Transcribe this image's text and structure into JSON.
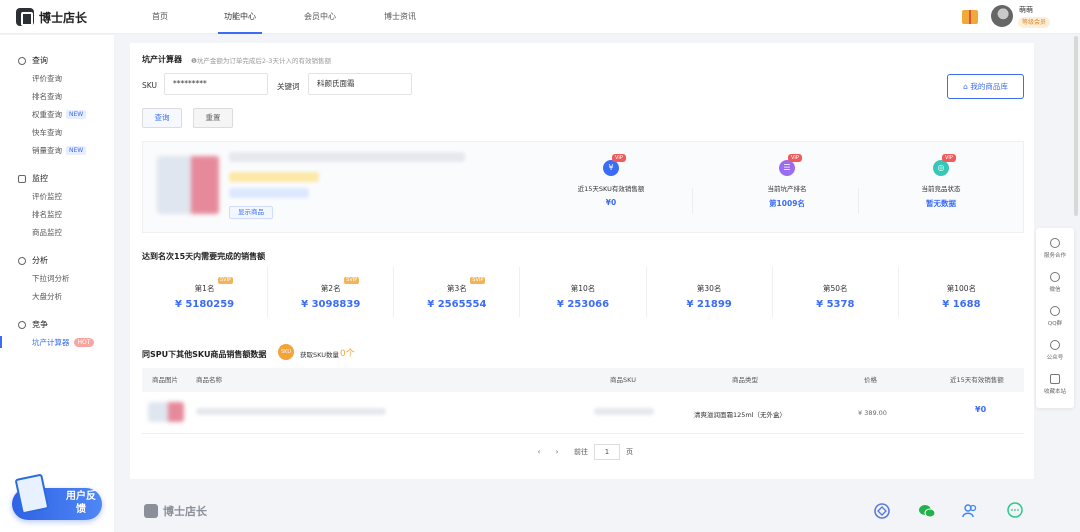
{
  "brand": {
    "name": "博士店长"
  },
  "nav": [
    "首页",
    "功能中心",
    "会员中心",
    "博士资讯"
  ],
  "user": {
    "name": "萌萌",
    "level": "等级会员"
  },
  "sidebar": {
    "groups": [
      {
        "title": "查询",
        "items": [
          {
            "label": "评价查询"
          },
          {
            "label": "排名查询"
          },
          {
            "label": "权重查询",
            "tag": "NEW"
          },
          {
            "label": "快车查询"
          },
          {
            "label": "销量查询",
            "tag": "NEW"
          }
        ]
      },
      {
        "title": "监控",
        "items": [
          {
            "label": "评价监控"
          },
          {
            "label": "排名监控"
          },
          {
            "label": "商品监控"
          }
        ]
      },
      {
        "title": "分析",
        "items": [
          {
            "label": "下拉词分析"
          },
          {
            "label": "大盘分析"
          }
        ]
      },
      {
        "title": "竞争",
        "items": [
          {
            "label": "坑产计算器",
            "tag": "HOT",
            "active": true
          }
        ]
      }
    ],
    "feedback": "用户反馈"
  },
  "calc": {
    "title": "坑产计算器",
    "hint": "❶坑产金额为订单完成后2-3天计入的有效销售额",
    "sku_label": "SKU",
    "sku_value": "*********",
    "keyword_label": "关键词",
    "keyword_value": "科颜氏面霜",
    "query_btn": "查询",
    "reset_btn": "重置",
    "library_btn": "我的商品库"
  },
  "product": {
    "show_btn": "显示商品",
    "stats": [
      {
        "label": "近15天SKU有效销售额",
        "value": "¥0",
        "vip": "VIP",
        "icon": "yen-icon",
        "color": "#3b6cf6"
      },
      {
        "label": "当前坑产排名",
        "value": "第1009名",
        "vip": "VIP",
        "icon": "rank-icon",
        "color": "#9b6cf0"
      },
      {
        "label": "当前竞品状态",
        "value": "暂无数据",
        "vip": "VIP",
        "icon": "status-icon",
        "color": "#35c7b8"
      }
    ]
  },
  "ranks": {
    "title": "达到名次15天内需要完成的销售额",
    "items": [
      {
        "name": "第1名",
        "value": "¥ 5180259",
        "vip": "SVIP"
      },
      {
        "name": "第2名",
        "value": "¥ 3098839",
        "vip": "SVIP"
      },
      {
        "name": "第3名",
        "value": "¥ 2565554",
        "vip": "SVIP"
      },
      {
        "name": "第10名",
        "value": "¥ 253066"
      },
      {
        "name": "第30名",
        "value": "¥ 21899"
      },
      {
        "name": "第50名",
        "value": "¥ 5378"
      },
      {
        "name": "第100名",
        "value": "¥ 1688"
      }
    ]
  },
  "spu": {
    "title": "同SPU下其他SKU商品销售额数据",
    "icon_text": "SKU",
    "count_label": "获取SKU数量",
    "count_value": "0个",
    "columns": [
      "商品图片",
      "商品名称",
      "商品SKU",
      "商品类型",
      "价格",
      "近15天有效销售额"
    ],
    "row": {
      "type": "清爽滋润面霜125ml（无外盒）",
      "price": "¥ 389.00",
      "sales": "¥0"
    }
  },
  "pager": {
    "prev": "‹",
    "next": "›",
    "goto_label": "前往",
    "page": "1",
    "page_suffix": "页"
  },
  "rightbar": [
    "服务合作",
    "微信",
    "QQ群",
    "公众号",
    "收藏本站"
  ],
  "footer": {
    "brand": "博士店长"
  }
}
